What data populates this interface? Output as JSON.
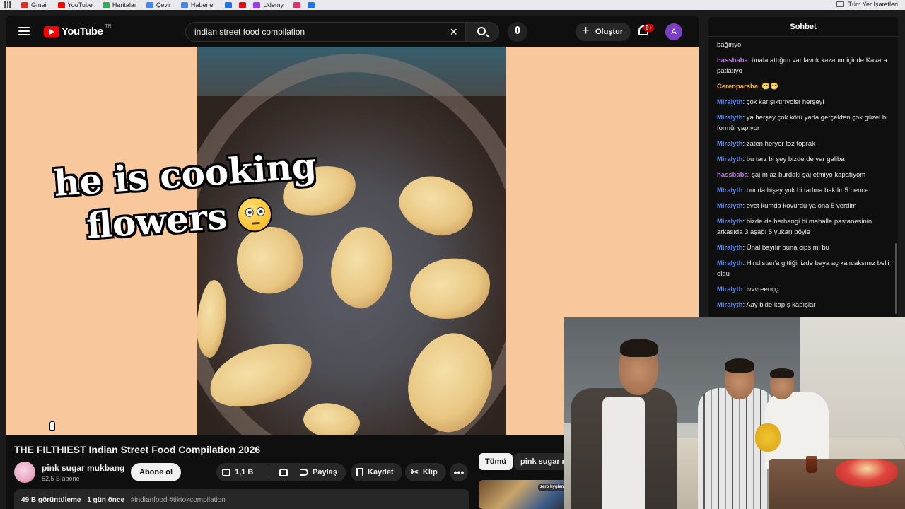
{
  "bookmarks": {
    "items": [
      {
        "label": "Gmail",
        "icon": "gmail-icon",
        "color": "#d93025"
      },
      {
        "label": "YouTube",
        "icon": "youtube-icon",
        "color": "#ff0000"
      },
      {
        "label": "Haritalar",
        "icon": "maps-icon",
        "color": "#34a853"
      },
      {
        "label": "Çevir",
        "icon": "translate-icon",
        "color": "#4285f4"
      },
      {
        "label": "Haberler",
        "icon": "news-icon",
        "color": "#4285f4"
      },
      {
        "label": "",
        "icon": "chrome-icon",
        "color": "#1a73e8"
      },
      {
        "label": "",
        "icon": "netflix-icon",
        "color": "#e50914"
      },
      {
        "label": "Udemy",
        "icon": "udemy-icon",
        "color": "#a435f0"
      },
      {
        "label": "",
        "icon": "instagram-icon",
        "color": "#e1306c"
      },
      {
        "label": "",
        "icon": "facebook-icon",
        "color": "#1877f2"
      }
    ],
    "all_bookmarks": "Tüm Yer İşaretleri"
  },
  "header": {
    "logo_text": "YouTube",
    "region": "TR",
    "search_value": "indian street food compilation",
    "create_label": "Oluştur",
    "notif_count": "9+",
    "avatar_letter": "A"
  },
  "video": {
    "overlay_line1": "he is cooking",
    "overlay_line2": "flowers",
    "title": "THE FILTHIEST Indian Street Food Compilation 2026"
  },
  "channel": {
    "name": "pink sugar mukbang",
    "subs": "52,5 B abone",
    "subscribe_label": "Abone ol"
  },
  "actions": {
    "likes": "1,1 B",
    "share": "Paylaş",
    "save": "Kaydet",
    "clip": "Klip",
    "more": "•••"
  },
  "description": {
    "views": "49 B görüntüleme",
    "time": "1 gün önce",
    "tags": "#indianfood #tiktokcompilation"
  },
  "chips": {
    "all": "Tümü",
    "channel": "pink sugar m"
  },
  "thumb_label": "zero hygiene",
  "chat": {
    "title": "Sohbet",
    "messages": [
      {
        "user": "",
        "color": "#e8e8e8",
        "text": "bağırıyo"
      },
      {
        "user": "hassbaba",
        "color": "#c36ef0",
        "text": "ünala attığım var lavuk kazanın içinde Kavara patlatıyo"
      },
      {
        "user": "Cerenparsha",
        "color": "#f5b640",
        "text": "😁😁"
      },
      {
        "user": "Miralyth",
        "color": "#5b8cf5",
        "text": "çok karışıktırıyolsr herşeyi"
      },
      {
        "user": "Miralyth",
        "color": "#5b8cf5",
        "text": "ya herşey çok kötü yada gerçekten çok güzel bi formül yapıyor"
      },
      {
        "user": "Miralyth",
        "color": "#5b8cf5",
        "text": "zaten heryer toz toprak"
      },
      {
        "user": "Miralyth",
        "color": "#5b8cf5",
        "text": "bu tarz bi şey bizde de var galiba"
      },
      {
        "user": "hassbaba",
        "color": "#c36ef0",
        "text": "şajım az burdaki şaj etmiyo kapatıyom"
      },
      {
        "user": "Miralyth",
        "color": "#5b8cf5",
        "text": "bunda bişey yok bi tadına bakılır 5 bence"
      },
      {
        "user": "Miralyth",
        "color": "#5b8cf5",
        "text": "evet kumda kovurdu ya ona 5 verdim"
      },
      {
        "user": "Miralyth",
        "color": "#5b8cf5",
        "text": "bizde de herhangi bi mahalle pastanesinin arkasıda 3 aşağı 5 yukarı böyle"
      },
      {
        "user": "Miralyth",
        "color": "#5b8cf5",
        "text": "Ünal bayılır buna cips mi bu"
      },
      {
        "user": "Miralyth",
        "color": "#5b8cf5",
        "text": "Hindistan'a gittiğinizde baya aç kalıcaksınız belli oldu"
      },
      {
        "user": "Miralyth",
        "color": "#5b8cf5",
        "text": "ivvvreençç"
      },
      {
        "user": "Miralyth",
        "color": "#5b8cf5",
        "text": "Aay bide kapış kapışlar"
      }
    ]
  }
}
